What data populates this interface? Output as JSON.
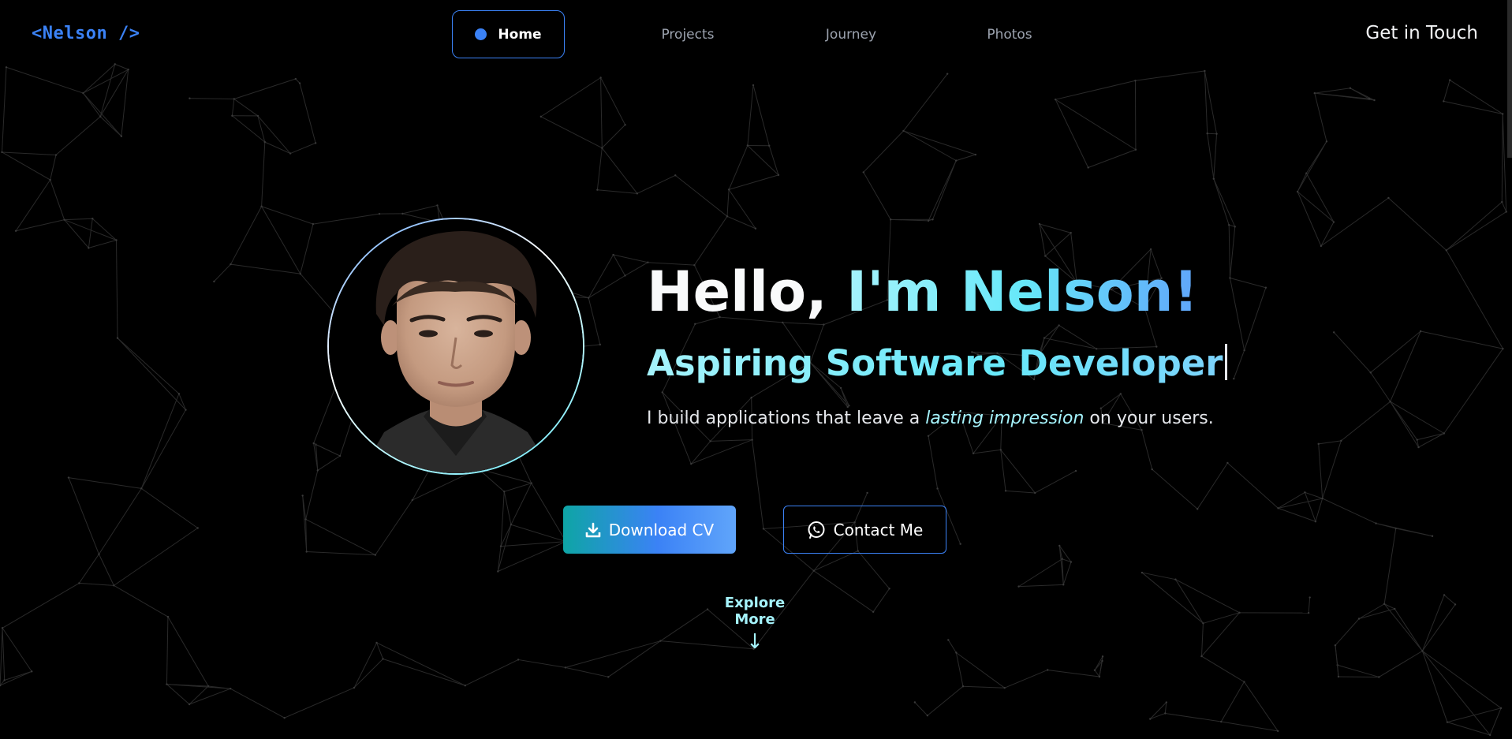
{
  "nav": {
    "logo": "<Nelson />",
    "items": [
      {
        "label": "Home",
        "active": true
      },
      {
        "label": "Projects",
        "active": false
      },
      {
        "label": "Journey",
        "active": false
      },
      {
        "label": "Photos",
        "active": false
      }
    ],
    "cta": "Get in Touch"
  },
  "hero": {
    "title_plain": "Hello, ",
    "title_highlight": "I'm Nelson!",
    "subtitle": "Aspiring Software Developer",
    "desc_before": "I build applications that leave a ",
    "desc_emphasis": "lasting impression",
    "desc_after": " on your users.",
    "avatar_alt": "Portrait photo of Nelson"
  },
  "buttons": {
    "download": {
      "label": "Download CV",
      "icon": "download-icon"
    },
    "contact": {
      "label": "Contact Me",
      "icon": "whatsapp-icon"
    }
  },
  "explore": {
    "label": "Explore More",
    "arrow": "↓"
  },
  "colors": {
    "background": "#000000",
    "accent_blue": "#3b82f6",
    "accent_cyan": "#67e8f9",
    "text_muted": "#9ca3af"
  }
}
